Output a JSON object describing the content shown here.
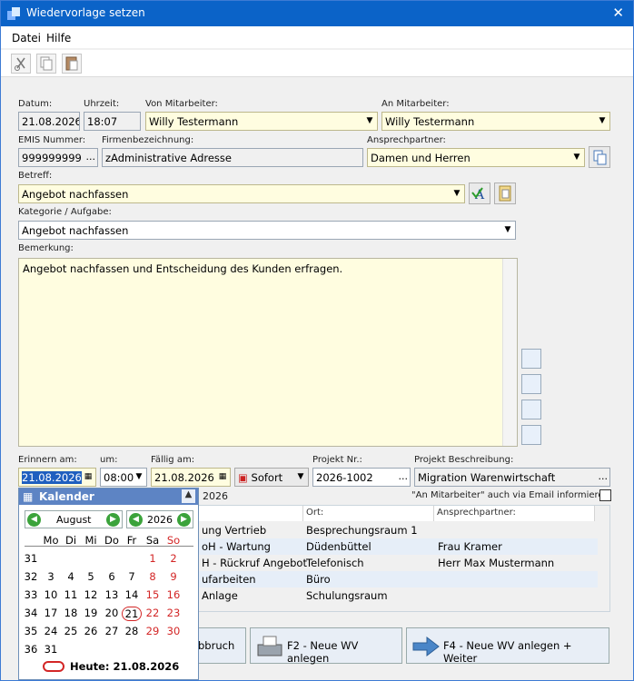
{
  "window": {
    "title": "Wiedervorlage setzen"
  },
  "menu": {
    "datei": "Datei",
    "hilfe": "Hilfe"
  },
  "form": {
    "datum_label": "Datum:",
    "datum": "21.08.2026",
    "uhrzeit_label": "Uhrzeit:",
    "uhrzeit": "18:07",
    "von_label": "Von Mitarbeiter:",
    "von": "Willy Testermann",
    "an_label": "An Mitarbeiter:",
    "an": "Willy Testermann",
    "emis_label": "EMIS Nummer:",
    "emis": "999999999",
    "firma_label": "Firmenbezeichnung:",
    "firma": "zAdministrative Adresse",
    "ansprech_label": "Ansprechpartner:",
    "ansprech": "Damen und Herren",
    "betreff_label": "Betreff:",
    "betreff": "Angebot nachfassen",
    "kategorie_label": "Kategorie / Aufgabe:",
    "kategorie": "Angebot nachfassen",
    "bemerkung_label": "Bemerkung:",
    "bemerkung": "Angebot nachfassen und Entscheidung des Kunden erfragen.",
    "erinnern_label": "Erinnern am:",
    "erinnern": "21.08.2026",
    "um_label": "um:",
    "um": "08:00",
    "faellig_label": "Fällig am:",
    "faellig": "21.08.2026",
    "sofort": "Sofort",
    "projekt_label": "Projekt Nr.:",
    "projekt": "2026-1002",
    "projektbeschr_label": "Projekt Beschreibung:",
    "projektbeschr": "Migration Warenwirtschaft",
    "email_info": "\"An Mitarbeiter\" auch via Email informieren",
    "partial_date": "2026",
    "ellipsis": "..."
  },
  "grid": {
    "headers": [
      "Ort:",
      "Ansprechpartner:"
    ],
    "rows": [
      {
        "c1": "ung Vertrieb",
        "c2": "Besprechungsraum 1",
        "c3": ""
      },
      {
        "c1": "oH - Wartung",
        "c2": "Düdenbüttel",
        "c3": "Frau Kramer"
      },
      {
        "c1": "H - Rückruf Angebot",
        "c2": "Telefonisch",
        "c3": "Herr Max Mustermann"
      },
      {
        "c1": "ufarbeiten",
        "c2": "Büro",
        "c3": ""
      },
      {
        "c1": "Anlage",
        "c2": "Schulungsraum",
        "c3": ""
      }
    ]
  },
  "buttons": {
    "abbruch": "bbruch",
    "f2": "F2 - Neue WV anlegen",
    "f4": "F4 - Neue WV anlegen + Weiter"
  },
  "calendar": {
    "title": "Kalender",
    "month": "August",
    "year": "2026",
    "weekdays": [
      "Mo",
      "Di",
      "Mi",
      "Do",
      "Fr",
      "Sa",
      "So"
    ],
    "weeks": [
      {
        "wk": "31",
        "days": [
          "",
          "",
          "",
          "",
          "",
          "1",
          "2"
        ]
      },
      {
        "wk": "32",
        "days": [
          "3",
          "4",
          "5",
          "6",
          "7",
          "8",
          "9"
        ]
      },
      {
        "wk": "33",
        "days": [
          "10",
          "11",
          "12",
          "13",
          "14",
          "15",
          "16"
        ]
      },
      {
        "wk": "34",
        "days": [
          "17",
          "18",
          "19",
          "20",
          "21",
          "22",
          "23"
        ]
      },
      {
        "wk": "35",
        "days": [
          "24",
          "25",
          "26",
          "27",
          "28",
          "29",
          "30"
        ]
      },
      {
        "wk": "36",
        "days": [
          "31",
          "",
          "",
          "",
          "",
          "",
          ""
        ]
      }
    ],
    "today": "Heute: 21.08.2026"
  },
  "colors": {
    "titlebar": "#0b63c8",
    "accent": "#5d84c4",
    "weekend": "#d32626"
  }
}
